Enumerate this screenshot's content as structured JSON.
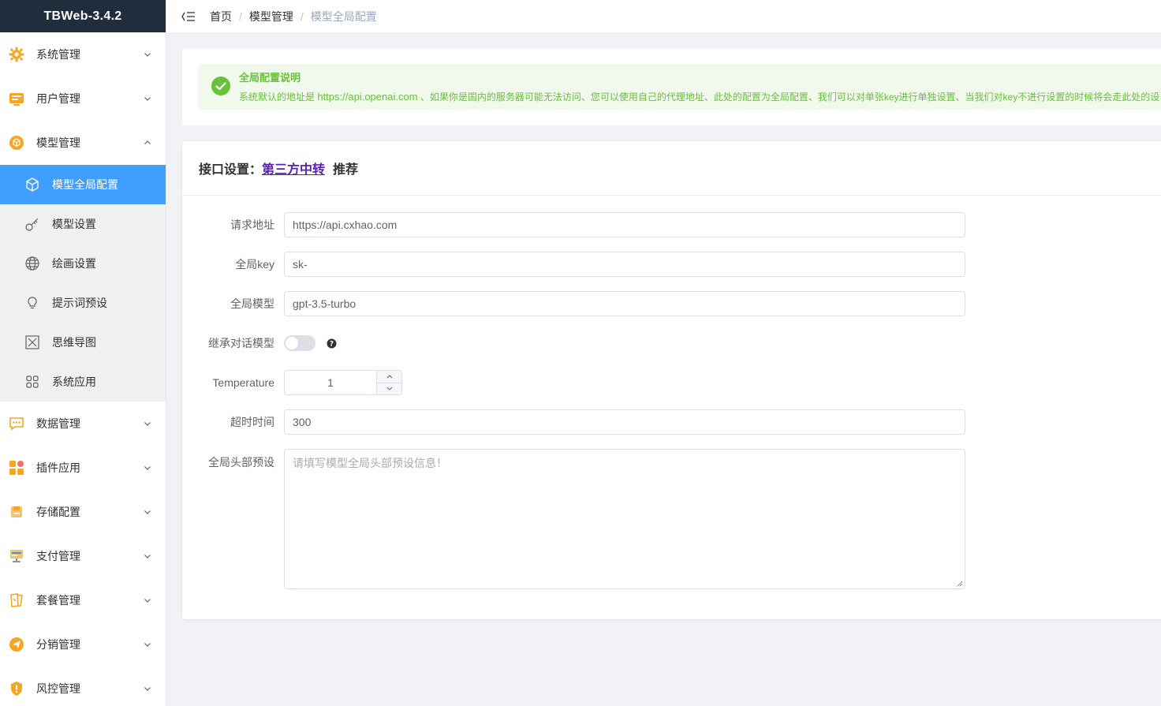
{
  "app": {
    "title": "TBWeb-3.4.2"
  },
  "colors": {
    "brand_bg": "#1f2d3d",
    "active": "#409eff",
    "success": "#67c23a",
    "link": "#5b21b6"
  },
  "sidebar": {
    "items": [
      {
        "label": "系统管理",
        "icon": "gear-icon",
        "expanded": false
      },
      {
        "label": "用户管理",
        "icon": "user-card-icon",
        "expanded": false
      },
      {
        "label": "模型管理",
        "icon": "model-icon",
        "expanded": true,
        "children": [
          {
            "label": "模型全局配置",
            "icon": "cube-icon",
            "active": true
          },
          {
            "label": "模型设置",
            "icon": "key-icon"
          },
          {
            "label": "绘画设置",
            "icon": "globe-icon"
          },
          {
            "label": "提示词预设",
            "icon": "bulb-icon"
          },
          {
            "label": "思维导图",
            "icon": "mindmap-icon"
          },
          {
            "label": "系统应用",
            "icon": "apps-icon"
          }
        ]
      },
      {
        "label": "数据管理",
        "icon": "chat-data-icon",
        "expanded": false
      },
      {
        "label": "插件应用",
        "icon": "plugin-icon",
        "expanded": false
      },
      {
        "label": "存储配置",
        "icon": "storage-icon",
        "expanded": false
      },
      {
        "label": "支付管理",
        "icon": "payment-icon",
        "expanded": false
      },
      {
        "label": "套餐管理",
        "icon": "package-icon",
        "expanded": false
      },
      {
        "label": "分销管理",
        "icon": "distribution-icon",
        "expanded": false
      },
      {
        "label": "风控管理",
        "icon": "shield-icon",
        "expanded": false
      }
    ]
  },
  "breadcrumb": [
    "首页",
    "模型管理",
    "模型全局配置"
  ],
  "alert": {
    "title": "全局配置说明",
    "desc_prefix": "系统默认的地址是 ",
    "desc_url": "https://api.openai.com",
    "desc_suffix": " 、如果你是国内的服务器可能无法访问、您可以使用自己的代理地址、此处的配置为全局配置、我们可以对单张key进行单独设置、当我们对key不进行设置的时候将会走此处的设"
  },
  "form": {
    "header_prefix": "接口设置：",
    "header_link": "第三方中转",
    "header_suffix": "推荐",
    "fields": {
      "request_url": {
        "label": "请求地址",
        "value": "https://api.cxhao.com"
      },
      "global_key": {
        "label": "全局key",
        "value": "sk-"
      },
      "global_model": {
        "label": "全局模型",
        "value": "gpt-3.5-turbo"
      },
      "inherit_model": {
        "label": "继承对话模型",
        "enabled": false
      },
      "temperature": {
        "label": "Temperature",
        "value": "1"
      },
      "timeout": {
        "label": "超时时间",
        "value": "300"
      },
      "header_preset": {
        "label": "全局头部预设",
        "placeholder": "请填写模型全局头部预设信息！"
      }
    }
  }
}
